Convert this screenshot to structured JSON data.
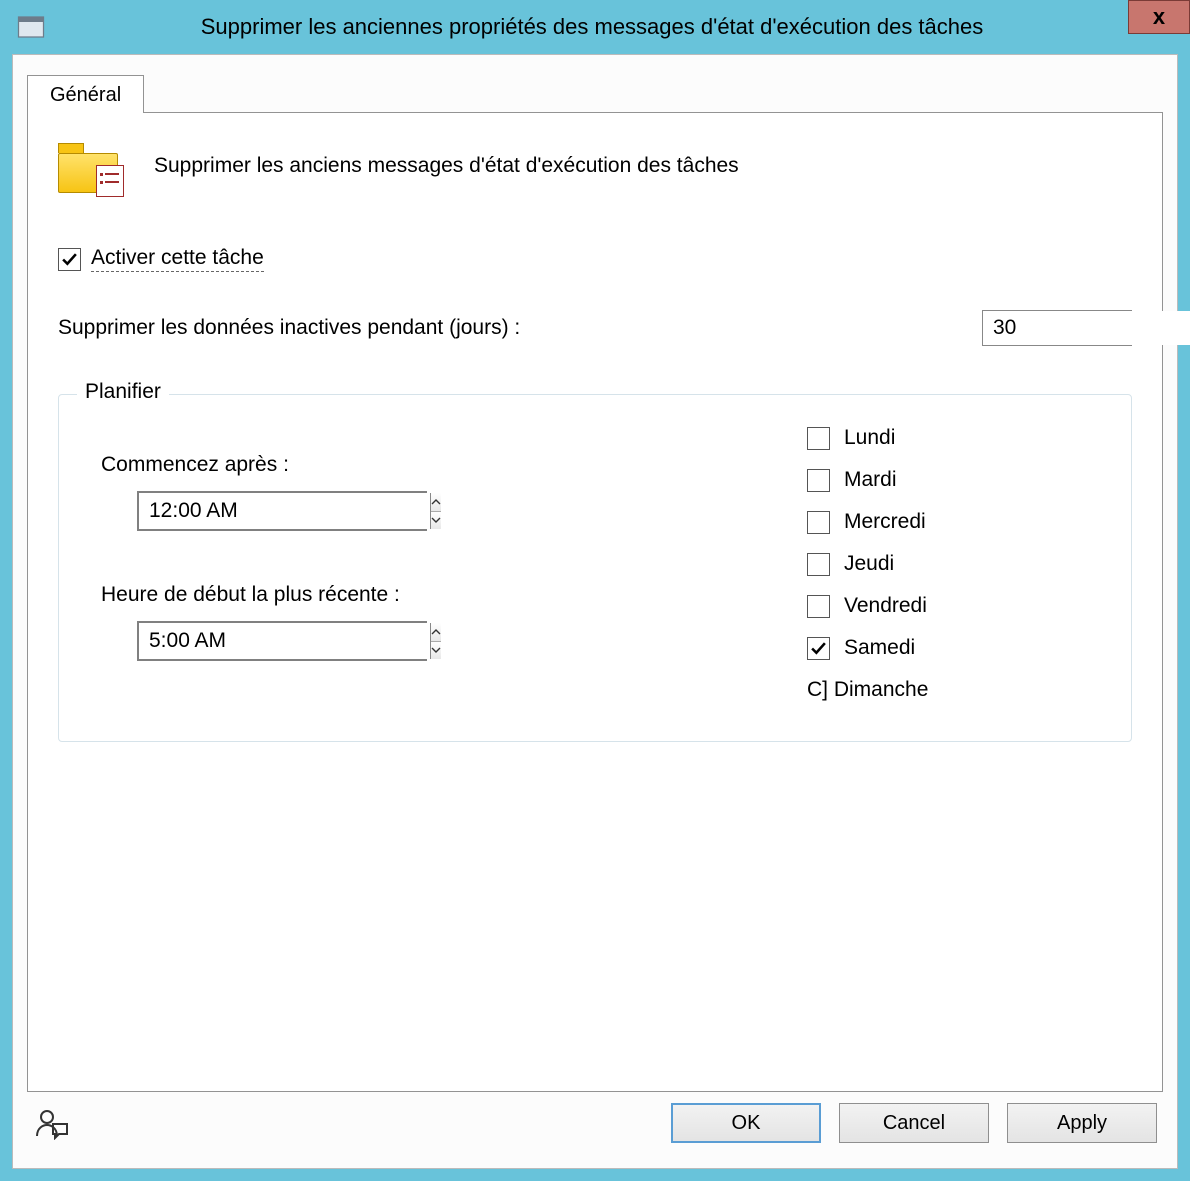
{
  "window": {
    "title": "Supprimer les anciennes propriétés des messages d'état d'exécution des tâches",
    "close_label": "x"
  },
  "tabs": {
    "general": "Général"
  },
  "header": {
    "description": "Supprimer les anciens messages d'état d'exécution des tâches"
  },
  "enable": {
    "label": "Activer cette tâche",
    "checked": true
  },
  "inactive_days": {
    "label": "Supprimer les données inactives pendant (jours) :",
    "value": "30"
  },
  "schedule": {
    "legend": "Planifier",
    "start_after_label": "Commencez après :",
    "start_after_value": "12:00 AM",
    "latest_start_label": "Heure de début la plus récente :",
    "latest_start_value": "5:00 AM",
    "days": [
      {
        "label": "Lundi",
        "checked": false
      },
      {
        "label": "Mardi",
        "checked": false
      },
      {
        "label": "Mercredi",
        "checked": false
      },
      {
        "label": "Jeudi",
        "checked": false
      },
      {
        "label": "Vendredi",
        "checked": false
      },
      {
        "label": "Samedi",
        "checked": true
      }
    ],
    "dimanche_text": "C] Dimanche"
  },
  "buttons": {
    "ok": "OK",
    "cancel": "Cancel",
    "apply": "Apply"
  }
}
